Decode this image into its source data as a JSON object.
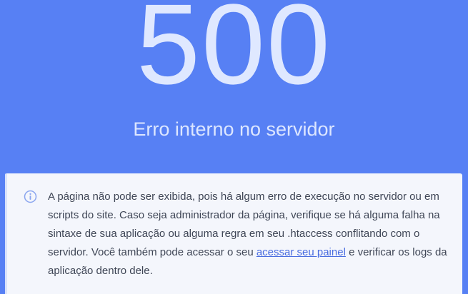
{
  "error": {
    "code": "500",
    "title": "Erro interno no servidor"
  },
  "notice": {
    "icon": "info-icon",
    "text_before": "A página não pode ser exibida, pois há algum erro de execução no servidor ou em scripts do site. Caso seja administrador da página, verifique se há alguma falha na sintaxe de sua aplicação ou alguma regra em seu .htaccess conflitando com o servidor. Você também pode acessar o seu ",
    "link_label": "acessar seu painel",
    "text_after": " e verificar os logs da aplicação dentro dele."
  },
  "colors": {
    "background": "#5780f4",
    "card": "#f4f6fc",
    "link": "#4a6de0",
    "text": "#3f4656"
  }
}
